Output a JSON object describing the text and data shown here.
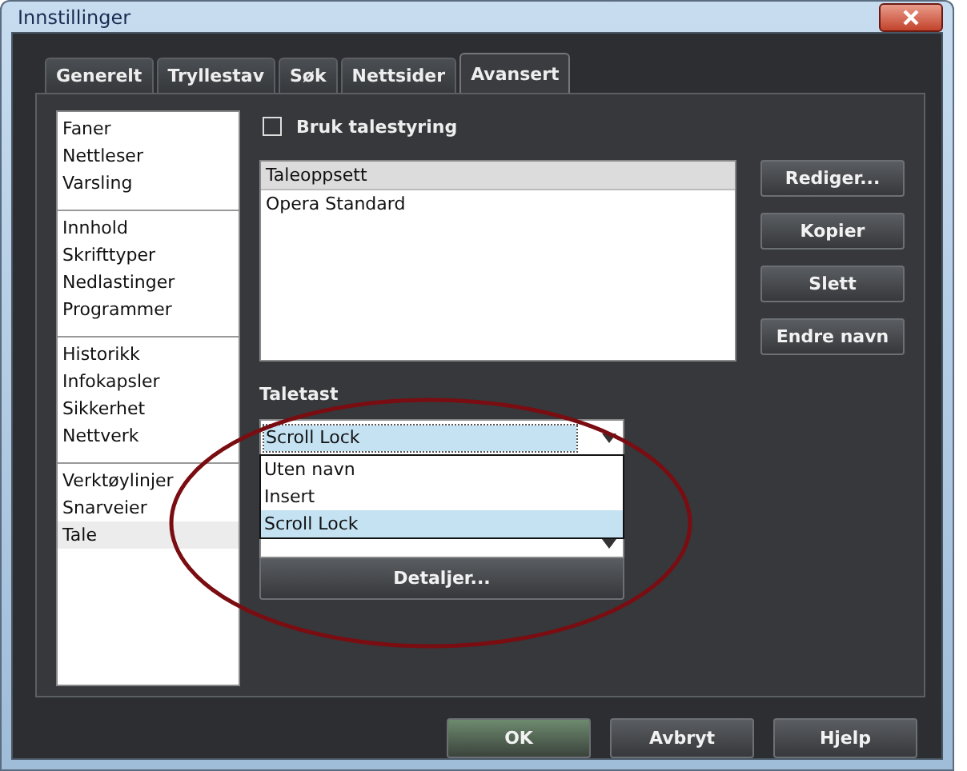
{
  "window": {
    "title": "Innstillinger"
  },
  "tabs": [
    {
      "label": "Generelt",
      "selected": false
    },
    {
      "label": "Tryllestav",
      "selected": false
    },
    {
      "label": "Søk",
      "selected": false
    },
    {
      "label": "Nettsider",
      "selected": false
    },
    {
      "label": "Avansert",
      "selected": true
    }
  ],
  "sidebar": {
    "groups": [
      {
        "items": [
          {
            "label": "Faner",
            "selected": false
          },
          {
            "label": "Nettleser",
            "selected": false
          },
          {
            "label": "Varsling",
            "selected": false
          }
        ]
      },
      {
        "items": [
          {
            "label": "Innhold",
            "selected": false
          },
          {
            "label": "Skrifttyper",
            "selected": false
          },
          {
            "label": "Nedlastinger",
            "selected": false
          },
          {
            "label": "Programmer",
            "selected": false
          }
        ]
      },
      {
        "items": [
          {
            "label": "Historikk",
            "selected": false
          },
          {
            "label": "Infokapsler",
            "selected": false
          },
          {
            "label": "Sikkerhet",
            "selected": false
          },
          {
            "label": "Nettverk",
            "selected": false
          }
        ]
      },
      {
        "items": [
          {
            "label": "Verktøylinjer",
            "selected": false
          },
          {
            "label": "Snarveier",
            "selected": false
          },
          {
            "label": "Tale",
            "selected": true
          }
        ]
      }
    ]
  },
  "voice_control": {
    "label": "Bruk talestyring",
    "checked": false
  },
  "speech_setup": {
    "header": "Taleoppsett",
    "items": [
      {
        "label": "Opera Standard",
        "selected": false
      }
    ]
  },
  "side_buttons": [
    "Rediger...",
    "Kopier",
    "Slett",
    "Endre navn"
  ],
  "hotkey": {
    "label": "Taletast",
    "value": "Scroll Lock",
    "expanded": true,
    "options": [
      {
        "label": "Uten navn",
        "selected": false
      },
      {
        "label": "Insert",
        "selected": false
      },
      {
        "label": "Scroll Lock",
        "selected": true
      }
    ]
  },
  "details_button": "Detaljer...",
  "buttons": [
    {
      "label": "OK",
      "default": true
    },
    {
      "label": "Avbryt",
      "default": false
    },
    {
      "label": "Hjelp",
      "default": false
    }
  ]
}
